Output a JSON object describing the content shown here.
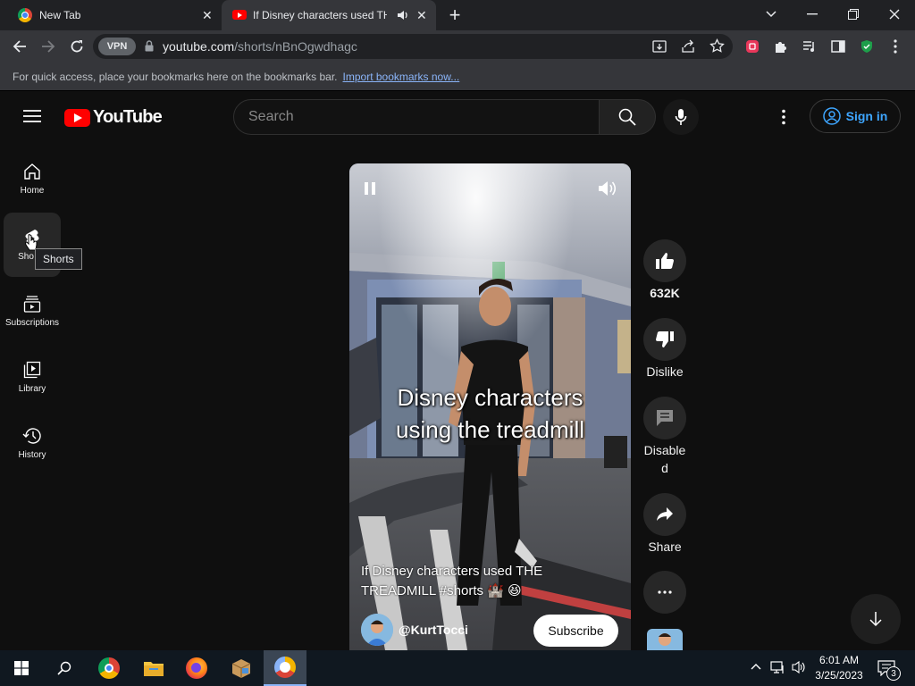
{
  "browser": {
    "tabs": [
      {
        "title": "New Tab"
      },
      {
        "title": "If Disney characters used THE"
      }
    ],
    "vpn_label": "VPN",
    "url_host": "youtube.com",
    "url_path": "/shorts/nBnOgwdhagc",
    "bookmarks_hint": "For quick access, place your bookmarks here on the bookmarks bar.",
    "import_link": "Import bookmarks now..."
  },
  "youtube": {
    "logo_text": "YouTube",
    "search_placeholder": "Search",
    "sign_in": "Sign in",
    "sidebar": [
      {
        "label": "Home",
        "icon": "home-icon"
      },
      {
        "label": "Shorts",
        "icon": "shorts-icon"
      },
      {
        "label": "Subscriptions",
        "icon": "subscriptions-icon"
      },
      {
        "label": "Library",
        "icon": "library-icon"
      },
      {
        "label": "History",
        "icon": "history-icon"
      }
    ],
    "sidebar_shorts_visible": "Sho",
    "tooltip": "Shorts"
  },
  "video": {
    "caption_line1": "Disney characters",
    "caption_line2": "using the treadmill",
    "title_line1": "If Disney characters used THE",
    "title_line2": "TREADMILL #shorts 🏰 😆",
    "channel": "@KurtTocci",
    "subscribe": "Subscribe"
  },
  "actions": {
    "likes": "632K",
    "dislike": "Dislike",
    "comments": "Disabled",
    "share": "Share"
  },
  "taskbar": {
    "time": "6:01 AM",
    "date": "3/25/2023",
    "notifications": "3"
  }
}
